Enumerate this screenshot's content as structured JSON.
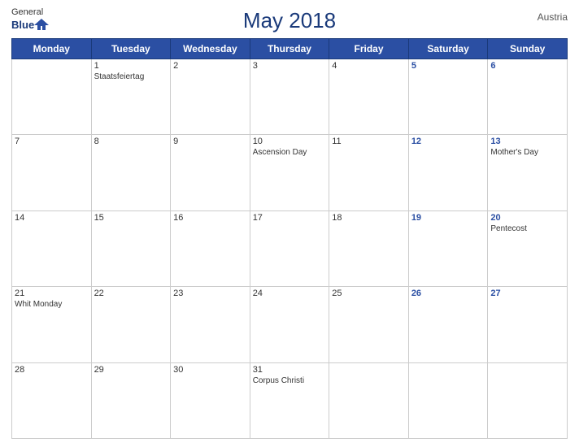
{
  "header": {
    "title": "May 2018",
    "country": "Austria",
    "logo_general": "General",
    "logo_blue": "Blue"
  },
  "weekdays": [
    "Monday",
    "Tuesday",
    "Wednesday",
    "Thursday",
    "Friday",
    "Saturday",
    "Sunday"
  ],
  "weeks": [
    [
      {
        "day": "",
        "holiday": ""
      },
      {
        "day": "1",
        "holiday": "Staatsfeiertag"
      },
      {
        "day": "2",
        "holiday": ""
      },
      {
        "day": "3",
        "holiday": ""
      },
      {
        "day": "4",
        "holiday": ""
      },
      {
        "day": "5",
        "holiday": "",
        "weekend": true
      },
      {
        "day": "6",
        "holiday": "",
        "weekend": true
      }
    ],
    [
      {
        "day": "7",
        "holiday": ""
      },
      {
        "day": "8",
        "holiday": ""
      },
      {
        "day": "9",
        "holiday": ""
      },
      {
        "day": "10",
        "holiday": "Ascension Day"
      },
      {
        "day": "11",
        "holiday": ""
      },
      {
        "day": "12",
        "holiday": "",
        "weekend": true
      },
      {
        "day": "13",
        "holiday": "Mother's Day",
        "weekend": true
      }
    ],
    [
      {
        "day": "14",
        "holiday": ""
      },
      {
        "day": "15",
        "holiday": ""
      },
      {
        "day": "16",
        "holiday": ""
      },
      {
        "day": "17",
        "holiday": ""
      },
      {
        "day": "18",
        "holiday": ""
      },
      {
        "day": "19",
        "holiday": "",
        "weekend": true
      },
      {
        "day": "20",
        "holiday": "Pentecost",
        "weekend": true
      }
    ],
    [
      {
        "day": "21",
        "holiday": "Whit Monday"
      },
      {
        "day": "22",
        "holiday": ""
      },
      {
        "day": "23",
        "holiday": ""
      },
      {
        "day": "24",
        "holiday": ""
      },
      {
        "day": "25",
        "holiday": ""
      },
      {
        "day": "26",
        "holiday": "",
        "weekend": true
      },
      {
        "day": "27",
        "holiday": "",
        "weekend": true
      }
    ],
    [
      {
        "day": "28",
        "holiday": ""
      },
      {
        "day": "29",
        "holiday": ""
      },
      {
        "day": "30",
        "holiday": ""
      },
      {
        "day": "31",
        "holiday": "Corpus Christi"
      },
      {
        "day": "",
        "holiday": ""
      },
      {
        "day": "",
        "holiday": "",
        "weekend": true
      },
      {
        "day": "",
        "holiday": "",
        "weekend": true
      }
    ]
  ]
}
